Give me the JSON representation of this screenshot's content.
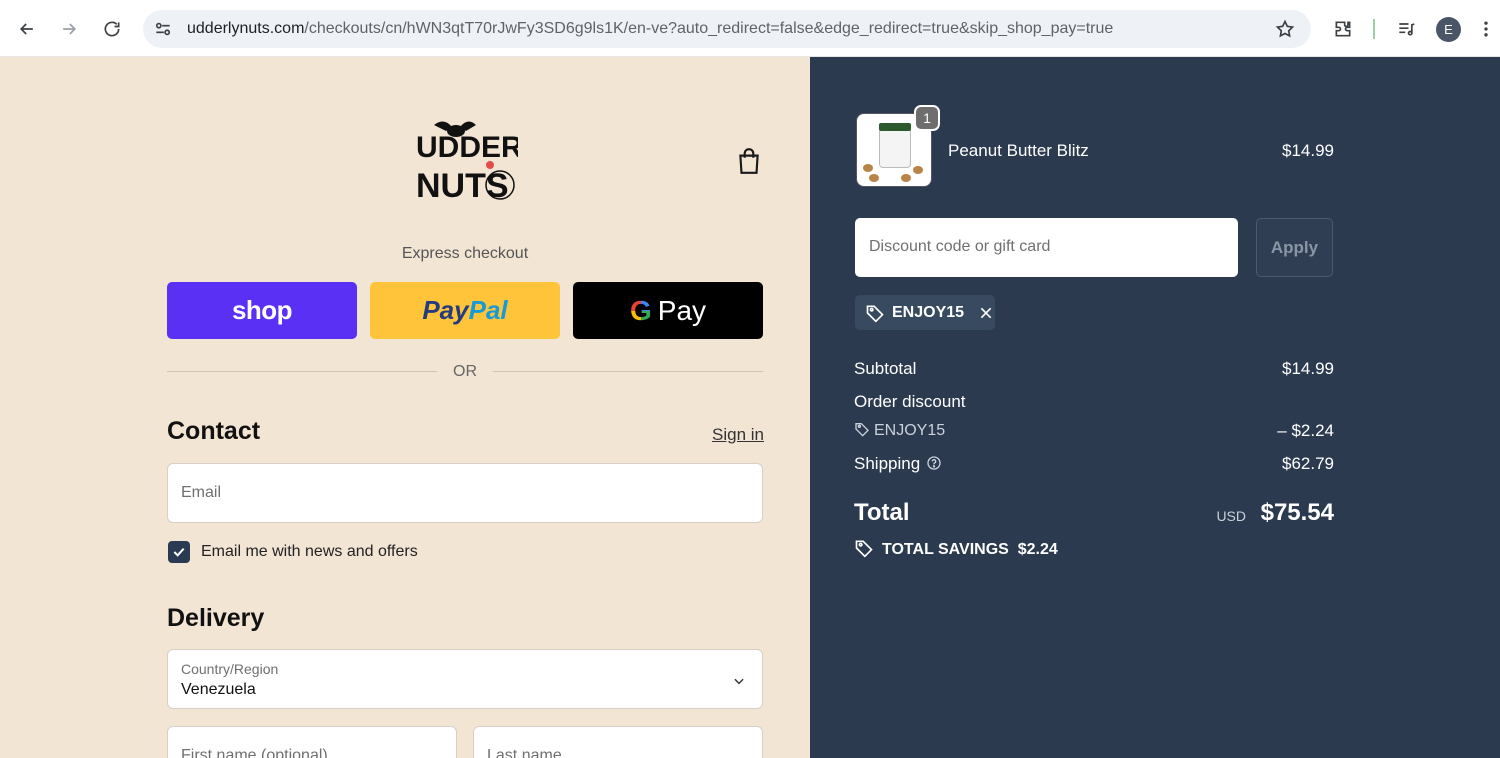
{
  "browser": {
    "url_host": "udderlynuts.com",
    "url_path": "/checkouts/cn/hWN3qtT70rJwFy3SD6g9ls1K/en-ve?auto_redirect=false&edge_redirect=true&skip_shop_pay=true",
    "avatar_letter": "E",
    "icons": [
      "back-icon",
      "forward-icon",
      "reload-icon",
      "site-info-icon",
      "bookmark-star-icon",
      "extensions-icon",
      "media-icon",
      "menu-icon"
    ]
  },
  "store": {
    "logo_text_line1": "UDDERLY",
    "logo_text_line2": "NUTS"
  },
  "express": {
    "label": "Express checkout",
    "shop_label": "shop",
    "paypal_part1": "Pay",
    "paypal_part2": "Pal",
    "gpay_g": "G",
    "gpay_label": "Pay",
    "or_label": "OR"
  },
  "contact": {
    "title": "Contact",
    "sign_in": "Sign in",
    "email_placeholder": "Email",
    "newsletter_label": "Email me with news and offers",
    "newsletter_checked": true
  },
  "delivery": {
    "title": "Delivery",
    "country_label": "Country/Region",
    "country_value": "Venezuela",
    "first_name_placeholder": "First name (optional)",
    "last_name_placeholder": "Last name"
  },
  "summary": {
    "item": {
      "name": "Peanut Butter Blitz",
      "price": "$14.99",
      "quantity": "1"
    },
    "discount_placeholder": "Discount code or gift card",
    "apply_label": "Apply",
    "applied_code": "ENJOY15",
    "subtotal_label": "Subtotal",
    "subtotal_value": "$14.99",
    "order_discount_label": "Order discount",
    "discount_code": "ENJOY15",
    "discount_value": "– $2.24",
    "shipping_label": "Shipping",
    "shipping_value": "$62.79",
    "total_label": "Total",
    "total_currency": "USD",
    "total_value": "$75.54",
    "savings_label": "TOTAL SAVINGS",
    "savings_value": "$2.24"
  },
  "colors": {
    "left_bg": "#f3e5d4",
    "right_bg": "#2b3a4f",
    "shop_pay": "#5a31f4",
    "paypal": "#ffc439",
    "gpay": "#000000"
  }
}
